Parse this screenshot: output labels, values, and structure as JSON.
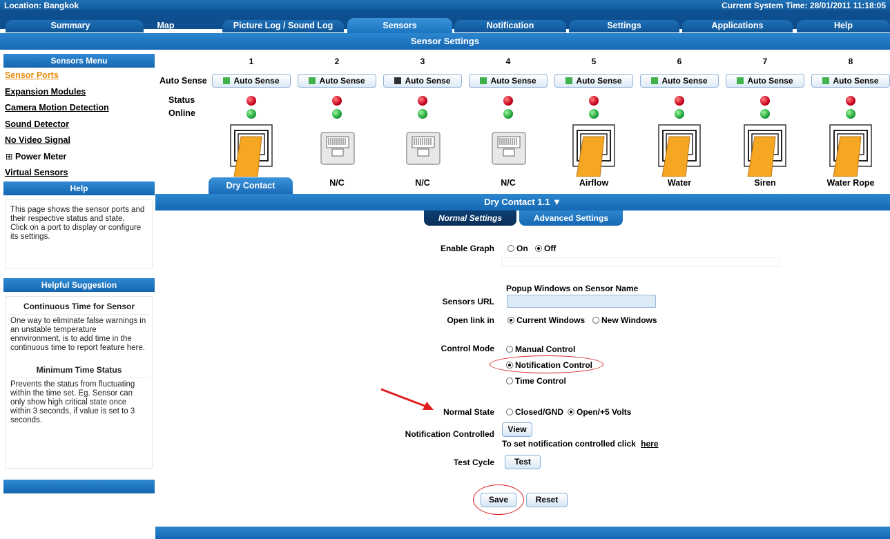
{
  "header": {
    "location": "Location: Bangkok",
    "system_time": "Current System Time: 28/01/2011 11:18:05"
  },
  "tabs": [
    {
      "label": "Summary"
    },
    {
      "label": "Map"
    },
    {
      "label": "Picture Log / Sound Log"
    },
    {
      "label": "Sensors"
    },
    {
      "label": "Notification"
    },
    {
      "label": "Settings"
    },
    {
      "label": "Applications"
    },
    {
      "label": "Help"
    }
  ],
  "active_tab": "Sensors",
  "page_title": "Sensor Settings",
  "sidebar": {
    "menu_title": "Sensors Menu",
    "items": [
      {
        "label": "Sensor Ports"
      },
      {
        "label": "Expansion Modules"
      },
      {
        "label": "Camera Motion Detection"
      },
      {
        "label": "Sound Detector"
      },
      {
        "label": "No Video Signal"
      },
      {
        "label": "Power Meter"
      },
      {
        "label": "Virtual Sensors"
      }
    ],
    "expand_glyph": "⊞",
    "help_title": "Help",
    "help_text": "This page shows the sensor ports and their respective status and state.\nClick on a port to display or configure its settings.",
    "suggestion_title": "Helpful Suggestion",
    "suggestions": [
      {
        "title": "Continuous Time for Sensor",
        "text": "One way to eliminate false warnings in an unstable temperature ennvironment, is to add time in the continuous time to report feature here."
      },
      {
        "title": "Minimum Time Status",
        "text": "Prevents the status from fluctuating within the time set. Eg. Sensor can only show high critical state once within 3 seconds, if value is set to 3 seconds."
      }
    ]
  },
  "ports": {
    "row_labels": {
      "auto_sense": "Auto Sense",
      "status": "Status",
      "online": "Online"
    },
    "auto_sense_label": "Auto Sense",
    "items": [
      {
        "num": "1",
        "name": "Dry Contact",
        "connected": true,
        "indicator": "green"
      },
      {
        "num": "2",
        "name": "N/C",
        "connected": false,
        "indicator": "green"
      },
      {
        "num": "3",
        "name": "N/C",
        "connected": false,
        "indicator": "black"
      },
      {
        "num": "4",
        "name": "N/C",
        "connected": false,
        "indicator": "green"
      },
      {
        "num": "5",
        "name": "Airflow",
        "connected": true,
        "indicator": "green"
      },
      {
        "num": "6",
        "name": "Water",
        "connected": true,
        "indicator": "green"
      },
      {
        "num": "7",
        "name": "Siren",
        "connected": true,
        "indicator": "green"
      },
      {
        "num": "8",
        "name": "Water Rope",
        "connected": true,
        "indicator": "green"
      }
    ]
  },
  "selected_sensor": "Dry Contact 1.1 ▼",
  "subtabs": {
    "normal": "Normal Settings",
    "advanced": "Advanced Settings"
  },
  "form": {
    "enable_graph": {
      "label": "Enable Graph",
      "on": "On",
      "off": "Off",
      "value": "Off"
    },
    "popup_title": "Popup Windows on Sensor Name",
    "sensors_url": {
      "label": "Sensors URL",
      "value": ""
    },
    "open_link": {
      "label": "Open link in",
      "current": "Current Windows",
      "new": "New Windows",
      "value": "Current Windows"
    },
    "control_mode": {
      "label": "Control Mode",
      "manual": "Manual Control",
      "notification": "Notification Control",
      "time": "Time Control",
      "value": "Notification Control"
    },
    "normal_state": {
      "label": "Normal State",
      "closed": "Closed/GND",
      "open": "Open/+5 Volts",
      "value": "Open/+5 Volts"
    },
    "notification_controlled": {
      "label": "Notification Controlled",
      "button": "View",
      "hint": "To set notification controlled click",
      "link": "here"
    },
    "test_cycle": {
      "label": "Test Cycle",
      "button": "Test"
    },
    "save": "Save",
    "reset": "Reset"
  },
  "colors": {
    "accent": "#1568b4",
    "active_link": "#e8890a",
    "highlight_red": "#d92020",
    "connector_orange": "#f5a623"
  }
}
